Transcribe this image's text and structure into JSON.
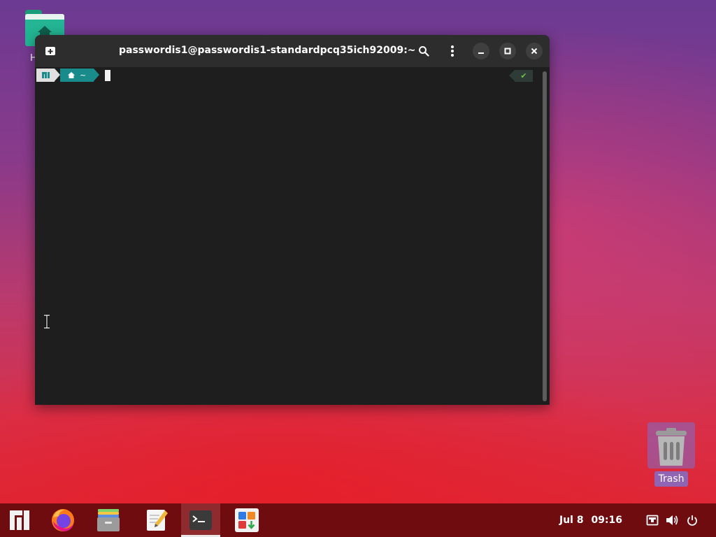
{
  "desktop": {
    "home_icon_label": "H",
    "trash_label": "Trash"
  },
  "terminal": {
    "title": "passwordis1@passwordis1-standardpcq35ich92009:~",
    "prompt_path": "~",
    "status_mark": "✔"
  },
  "taskbar": {
    "apps": [
      "Manjaro menu",
      "Firefox",
      "Files",
      "Text Editor",
      "Terminal",
      "Software"
    ],
    "date": "Jul 8",
    "time": "09:16"
  },
  "colors": {
    "accent": "#1a8b8b",
    "taskbar": "#6e0c10",
    "terminal_bg": "#1e1e1e"
  }
}
